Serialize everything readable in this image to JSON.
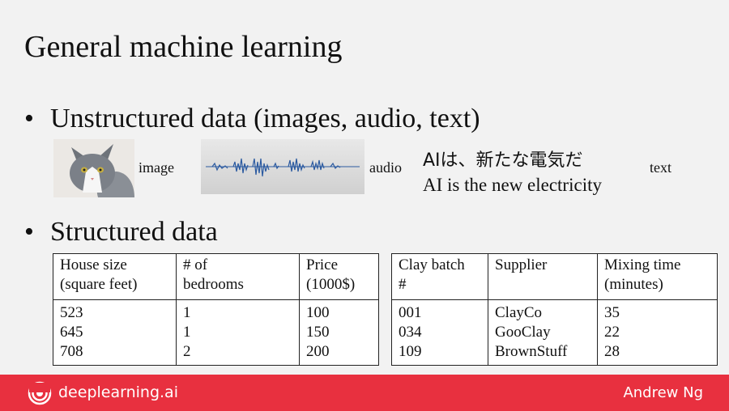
{
  "title": "General machine learning",
  "unstructured": {
    "heading": "Unstructured data (images, audio, text)",
    "image_label": "image",
    "audio_label": "audio",
    "text_label": "text",
    "text_japanese": "AIは、新たな電気だ",
    "text_english": "AI is the new electricity"
  },
  "structured": {
    "heading": "Structured data",
    "house_table": {
      "headers": [
        "House size\n(square feet)",
        "# of\nbedrooms",
        "Price\n(1000$)"
      ],
      "rows": [
        [
          "523",
          "1",
          "100"
        ],
        [
          "645",
          "1",
          "150"
        ],
        [
          "708",
          "2",
          "200"
        ]
      ]
    },
    "clay_table": {
      "headers": [
        "Clay batch\n#",
        "Supplier",
        "Mixing time\n(minutes)"
      ],
      "rows": [
        [
          "001",
          "ClayCo",
          "35"
        ],
        [
          "034",
          "GooClay",
          "22"
        ],
        [
          "109",
          "BrownStuff",
          "28"
        ]
      ]
    }
  },
  "footer": {
    "brand": "deeplearning.ai",
    "author": "Andrew Ng",
    "color": "#e8303f"
  }
}
